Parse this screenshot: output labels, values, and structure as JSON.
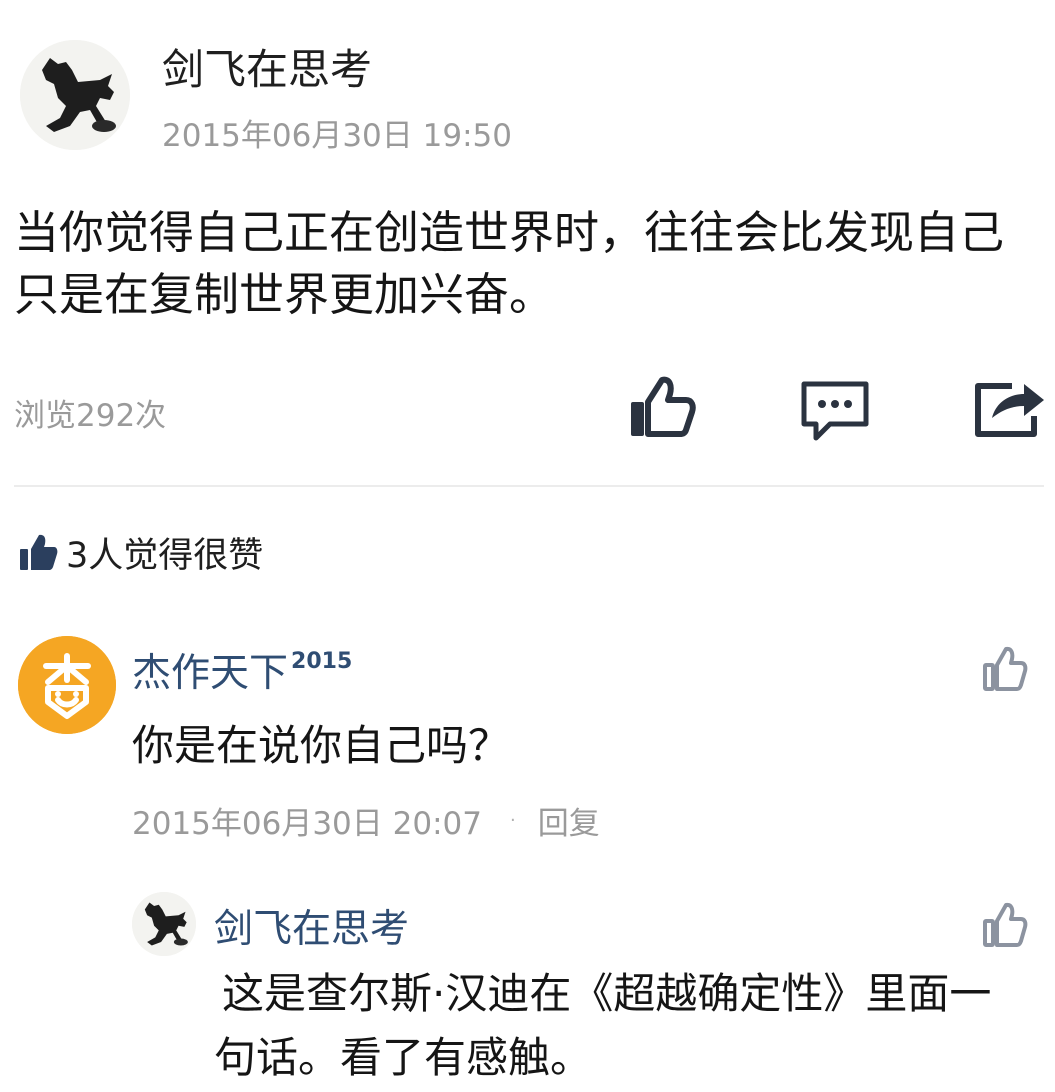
{
  "post": {
    "author": "剑飞在思考",
    "timestamp": "2015年06月30日 19:50",
    "body": "当你觉得自己正在创造世界时，往往会比发现自己只是在复制世界更加兴奋。",
    "views": "浏览292次",
    "actions": {
      "like_icon": "thumbs-up-icon",
      "comment_icon": "comment-icon",
      "share_icon": "share-icon"
    }
  },
  "likes": {
    "icon": "thumbs-up-icon",
    "label": "3人觉得很赞"
  },
  "comments": [
    {
      "author": "杰作天下",
      "author_badge": "2015",
      "text": "你是在说你自己吗？",
      "timestamp": "2015年06月30日 20:07",
      "separator": "·",
      "reply_label": "回复",
      "replies": [
        {
          "author": "剑飞在思考",
          "text": "这是查尔斯·汉迪在《超越确定性》里面一句话。看了有感触。"
        }
      ]
    }
  ],
  "colors": {
    "name_link": "#2f4d73",
    "muted": "#9a9a9a",
    "avatar_orange": "#f5a623"
  }
}
